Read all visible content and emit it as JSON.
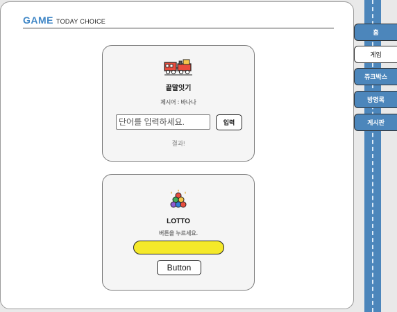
{
  "header": {
    "title": "GAME",
    "subtitle": "TODAY CHOICE"
  },
  "word_game": {
    "title": "끝말잇기",
    "prompt": "제시어 : 바나나",
    "input_placeholder": "단어를 입력하세요.",
    "enter_label": "입력",
    "result": "결과!",
    "icon": "train-icon"
  },
  "lotto": {
    "title": "LOTTO",
    "hint": "버튼을 누르세요.",
    "button_label": "Button",
    "icon": "lotto-balls-icon",
    "bar_color": "#f5e92a"
  },
  "nav": {
    "items": [
      {
        "label": "홈",
        "active": false
      },
      {
        "label": "게임",
        "active": true
      },
      {
        "label": "쥬크박스",
        "active": false
      },
      {
        "label": "방명록",
        "active": false
      },
      {
        "label": "게시판",
        "active": false
      }
    ]
  },
  "colors": {
    "accent": "#4c86bb",
    "title": "#3f86c6",
    "card_bg": "#f5f5f5"
  }
}
